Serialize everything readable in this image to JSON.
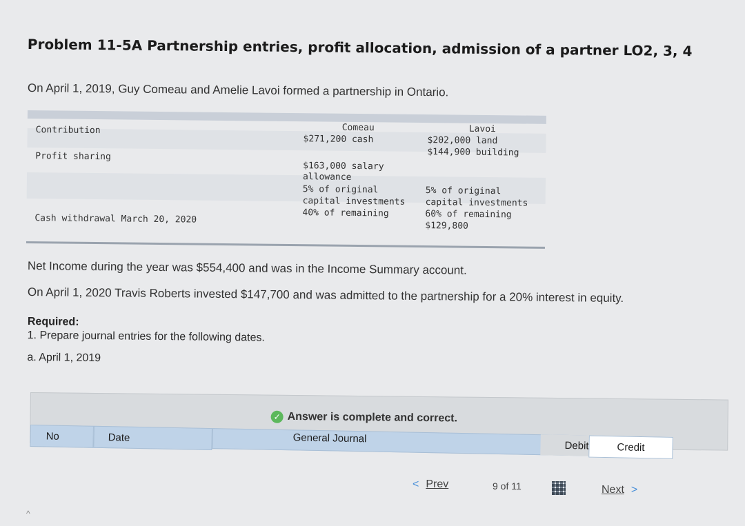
{
  "title": "Problem 11-5A Partnership entries, profit allocation, admission of a partner LO2, 3, 4",
  "intro": "On April 1, 2019, Guy Comeau and Amelie Lavoi formed a partnership in Ontario.",
  "table": {
    "row_contribution": "Contribution",
    "row_profit": "Profit sharing",
    "row_withdrawal": "Cash withdrawal March 20, 2020",
    "comeau": {
      "name": "Comeau",
      "contribution": "$271,200 cash",
      "salary_1": "$163,000 salary",
      "salary_2": "allowance",
      "pct_1": "5% of original",
      "pct_2": "capital investments",
      "remaining": "40% of remaining"
    },
    "lavoi": {
      "name": "Lavoi",
      "contribution_1": "$202,000 land",
      "contribution_2": "$144,900 building",
      "pct_1": "5% of original",
      "pct_2": "capital investments",
      "remaining": "60% of remaining",
      "withdrawal": "$129,800"
    }
  },
  "net_income": "Net Income during the year was $554,400 and was in the Income Summary account.",
  "roberts": "On April 1, 2020 Travis Roberts invested $147,700 and was admitted to the partnership for a 20% interest in equity.",
  "required_label": "Required:",
  "required_item": "1. Prepare journal entries for the following dates.",
  "date_item": "a. April 1, 2019",
  "answer_status": "Answer is complete and correct.",
  "journal": {
    "title": "General Journal",
    "col_no": "No",
    "col_date": "Date",
    "col_debit": "Debit",
    "col_credit": "Credit"
  },
  "pager": {
    "prev": "Prev",
    "position": "9 of 11",
    "next": "Next"
  },
  "colors": {
    "check": "#5cb85c",
    "header_blue": "#bfd3e8"
  }
}
